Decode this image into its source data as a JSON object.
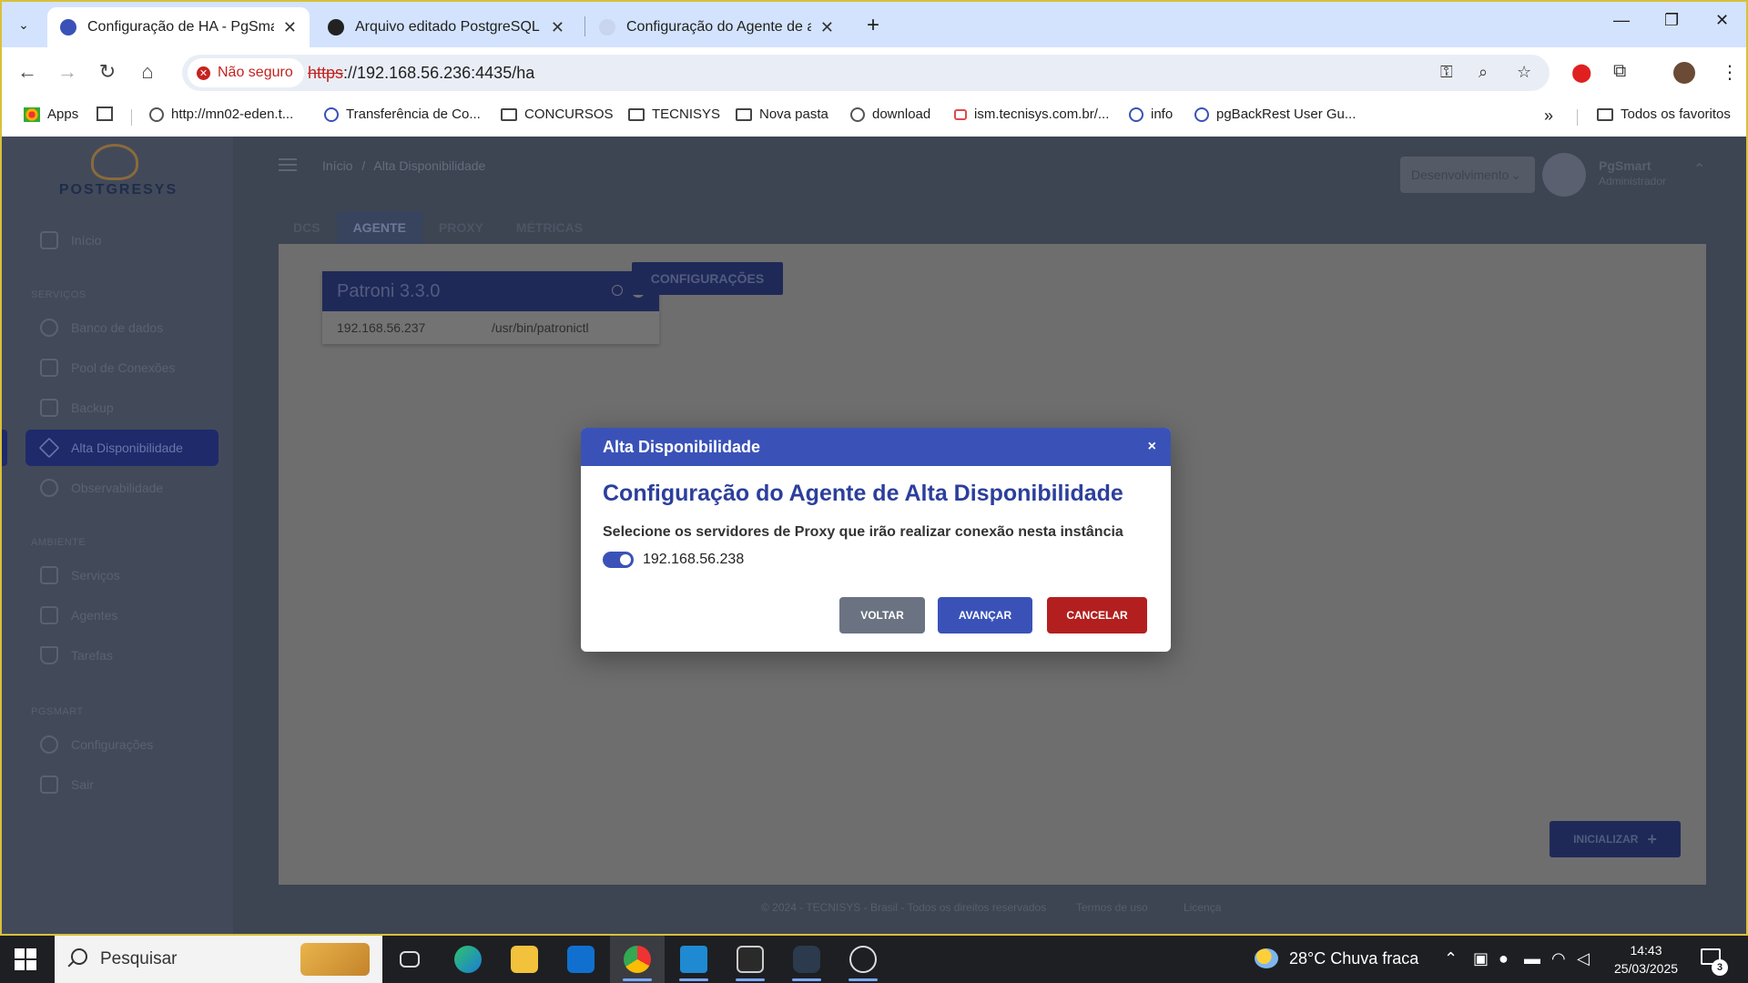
{
  "browser": {
    "tabs": [
      {
        "title": "Configuração de HA - PgSmart",
        "active": true
      },
      {
        "title": "Arquivo editado PostgreSQL",
        "active": false
      },
      {
        "title": "Configuração do Agente de alta",
        "active": false
      }
    ],
    "security_label": "Não seguro",
    "url_scheme": "https",
    "url_rest": "://192.168.56.236:4435/ha",
    "bookmarks": [
      "Apps",
      "http://mn02-eden.t...",
      "Transferência de Co...",
      "CONCURSOS",
      "TECNISYS",
      "Nova pasta",
      "download",
      "ism.tecnisys.com.br/...",
      "info",
      "pgBackRest User Gu..."
    ],
    "all_bookmarks_label": "Todos os favoritos"
  },
  "app": {
    "logo_text": "POSTGRESYS",
    "sidebar": {
      "home": "Início",
      "section_services": "SERVIÇOS",
      "services": [
        "Banco de dados",
        "Pool de Conexões",
        "Backup",
        "Alta Disponibilidade",
        "Observabilidade"
      ],
      "section_environment": "AMBIENTE",
      "environment": [
        "Serviços",
        "Agentes",
        "Tarefas"
      ],
      "section_pgsmart": "PGSMART",
      "pgsmart": [
        "Configurações",
        "Sair"
      ]
    },
    "breadcrumb": {
      "home": "Início",
      "separator": "/",
      "current": "Alta Disponibilidade"
    },
    "environment_select": "Desenvolvimento",
    "user": {
      "name": "PgSmart",
      "role": "Administrador"
    },
    "tabs": [
      "DCS",
      "AGENTE",
      "PROXY",
      "MÉTRICAS"
    ],
    "active_tab": "AGENTE",
    "patroni": {
      "title": "Patroni 3.3.0",
      "ip": "192.168.56.237",
      "path": "/usr/bin/patronictl"
    },
    "config_button": "CONFIGURAÇÕES",
    "init_button": "INICIALIZAR",
    "footer": {
      "copyright": "© 2024 - TECNISYS - Brasil - Todos os direitos reservados",
      "terms": "Termos de uso",
      "license": "Licença"
    }
  },
  "modal": {
    "header": "Alta Disponibilidade",
    "close": "×",
    "title": "Configuração do Agente de Alta Disponibilidade",
    "subtitle": "Selecione os servidores de Proxy que irão realizar conexão nesta instância",
    "proxy_server": "192.168.56.238",
    "proxy_enabled": true,
    "buttons": {
      "back": "VOLTAR",
      "next": "AVANÇAR",
      "cancel": "CANCELAR"
    }
  },
  "taskbar": {
    "search_placeholder": "Pesquisar",
    "weather": "28°C  Chuva fraca",
    "time": "14:43",
    "date": "25/03/2025",
    "notifications": "3"
  },
  "colors": {
    "modal_header": "#3a52b8",
    "cancel": "#b31f1f",
    "back": "#6b7383",
    "security_warning": "#c5221f"
  }
}
